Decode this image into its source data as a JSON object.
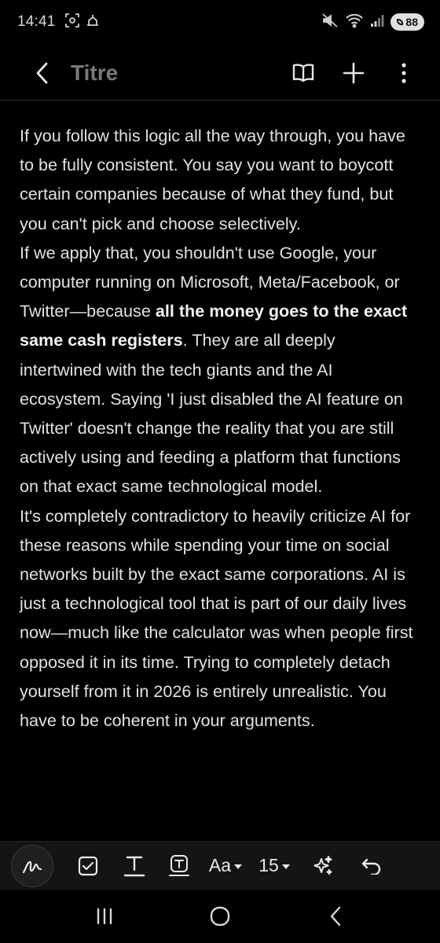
{
  "status_bar": {
    "time": "14:41",
    "battery": "88",
    "icons": [
      "screenshot-icon",
      "cast-icon",
      "mute-icon",
      "wifi-icon",
      "signal-icon",
      "battery-icon"
    ]
  },
  "app_bar": {
    "title": "Titre",
    "actions": [
      "book-icon",
      "plus-icon",
      "more-vert-icon"
    ]
  },
  "note": {
    "p1_a": "If you follow this logic all the way through, you have to be fully consistent. You say you want to boycott certain companies because of what they fund, but you can't pick and choose selectively.",
    "p2_a": "If we apply that, you shouldn't use Google, your computer running on Microsoft, Meta/Facebook, or Twitter—because ",
    "p2_bold": "all the money goes to the exact same cash registers",
    "p2_b": ". They are all deeply intertwined with the tech giants and the AI ecosystem. Saying 'I just disabled the AI feature on Twitter' doesn't change the reality that you are still actively using and feeding a platform that functions on that exact same technological model.",
    "p3": "It's completely contradictory to heavily criticize AI for these reasons while spending your time on social networks built by the exact same corporations. AI is just a technological tool that is part of our daily lives now—much like the calculator was when people first opposed it in its time. Trying to completely detach yourself from it in 2026 is entirely unrealistic. You have to be coherent in your arguments."
  },
  "toolbar": {
    "font_label": "Aa",
    "size_label": "15",
    "tools": [
      "pen-icon",
      "checkbox-icon",
      "text-style-icon",
      "text-box-icon",
      "font-style",
      "font-size",
      "ai-sparkle-icon",
      "undo-icon"
    ]
  },
  "nav_bar": {
    "buttons": [
      "recents-icon",
      "home-icon",
      "back-icon"
    ]
  },
  "colors": {
    "background": "#000000",
    "text": "#e2e2e2",
    "title": "#7a7a7a",
    "toolbar": "#141414"
  }
}
